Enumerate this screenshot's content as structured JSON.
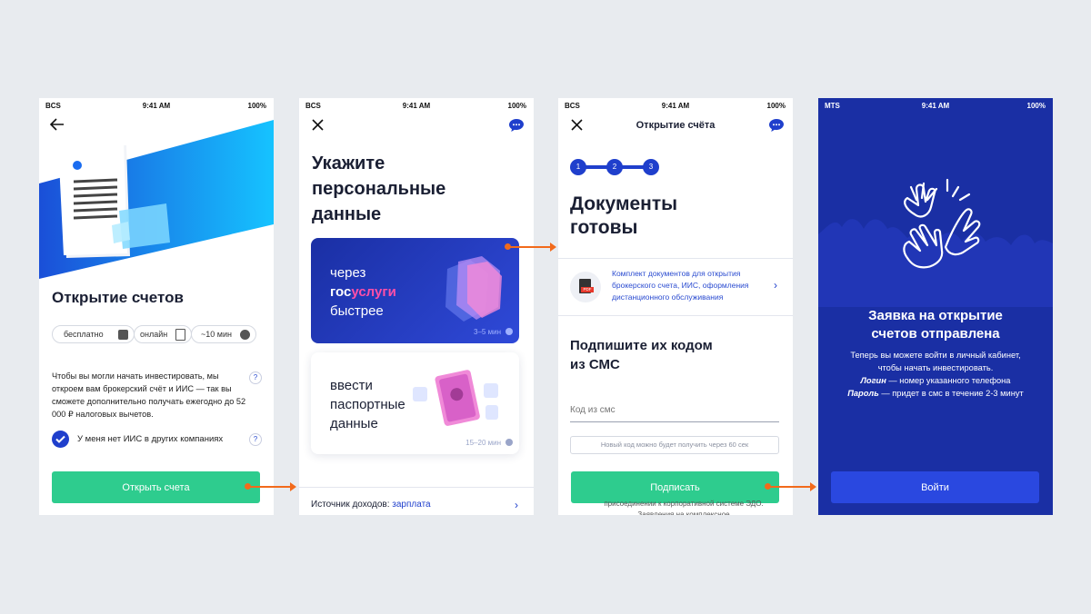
{
  "screen1": {
    "status": {
      "carrier": "BCS",
      "time": "9:41 AM",
      "battery": "100%"
    },
    "title": "Открытие счетов",
    "chips": [
      "бесплатно",
      "онлайн",
      "~10 мин"
    ],
    "description": "Чтобы вы могли начать инвестировать, мы откроем вам брокерский счёт и ИИС — так вы сможете дополнительно получать ежегодно до 52 000 ₽ налоговых вычетов.",
    "help_mark": "?",
    "checkbox_label": "У меня нет ИИС в других компаниях",
    "button_label": "Открыть счета"
  },
  "screen2": {
    "status": {
      "carrier": "BCS",
      "time": "9:41 AM",
      "battery": "100%"
    },
    "title_lines": [
      "Укажите",
      "персональные",
      "данные"
    ],
    "card1": {
      "line1": "через",
      "gos": "гос",
      "uslugi": "услуги",
      "line3": "быстрее",
      "time": "3–5 мин"
    },
    "card2": {
      "lines": [
        "ввести",
        "паспортные",
        "данные"
      ],
      "time": "15–20 мин"
    },
    "income_label": "Источник доходов:",
    "income_value": "зарплата"
  },
  "screen3": {
    "status": {
      "carrier": "BCS",
      "time": "9:41 AM",
      "battery": "100%"
    },
    "header_title": "Открытие счёта",
    "steps": [
      "1",
      "2",
      "3"
    ],
    "title_lines": [
      "Документы",
      "готовы"
    ],
    "doc_badge": "PDF",
    "doc_text": "Комплект документов для открытия брокерского счета, ИИС, оформления дистанционного обслуживания",
    "sms_title_lines": [
      "Подпишите их кодом",
      "из СМС"
    ],
    "sms_placeholder": "Код из смс",
    "resend_text": "Новый код можно будет получить через 60 сек",
    "button_label": "Подписать",
    "footer_text": "присоединении к корпоративной системе ЭДО. Заявления на комплексное"
  },
  "screen4": {
    "status": {
      "carrier": "MTS",
      "time": "9:41 AM",
      "battery": "100%"
    },
    "title_lines": [
      "Заявка на открытие",
      "счетов отправлена"
    ],
    "text_line1": "Теперь вы можете войти в личный кабинет,",
    "text_line2": "чтобы начать инвестировать.",
    "login_label": "Логин",
    "login_text": " — номер указанного телефона",
    "password_label": "Пароль",
    "password_text": " — придет в смс в течение 2-3 минут",
    "button_label": "Войти"
  },
  "colors": {
    "green": "#2ecc8e",
    "blue": "#1a2fa4",
    "accent_orange": "#f26a1b",
    "pink": "#ff4fa8"
  }
}
